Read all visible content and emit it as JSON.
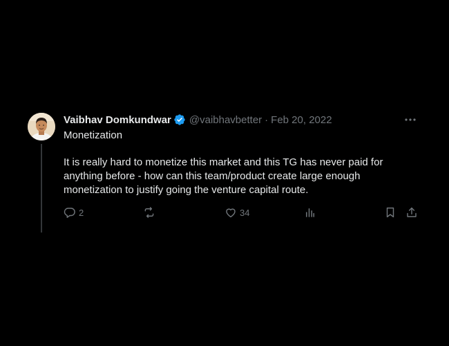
{
  "tweet": {
    "author_name": "Vaibhav Domkundwar",
    "handle": "@vaibhavbetter",
    "separator": "·",
    "date": "Feb 20, 2022",
    "title": "Monetization",
    "body_lines": [
      "It is really hard to monetize this market and this TG has never paid for",
      "anything before - how can this team/product create large enough",
      "monetization to justify going the venture capital route."
    ],
    "replies": "2",
    "likes": "34"
  },
  "icons": {
    "avatar": "user-avatar",
    "verified": "verified-badge-icon",
    "more": "more-options-icon",
    "reply": "reply-icon",
    "retweet": "retweet-icon",
    "like": "like-icon",
    "views": "analytics-icon",
    "bookmark": "bookmark-icon",
    "share": "share-icon"
  },
  "colors": {
    "background": "#000000",
    "text": "#e7e9ea",
    "muted": "#71767b",
    "verified": "#1d9bf0",
    "thread_line": "#333639"
  }
}
